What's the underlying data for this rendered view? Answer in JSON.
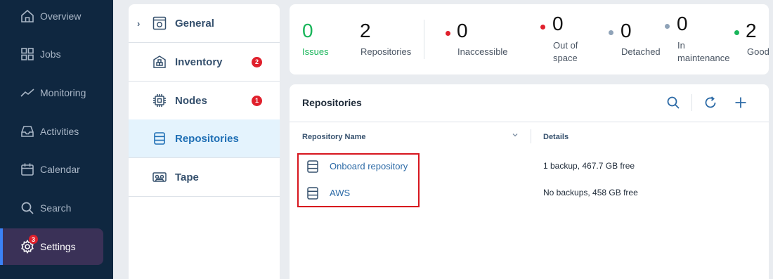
{
  "nav": {
    "items": [
      {
        "label": "Overview"
      },
      {
        "label": "Jobs"
      },
      {
        "label": "Monitoring"
      },
      {
        "label": "Activities"
      },
      {
        "label": "Calendar"
      },
      {
        "label": "Search"
      },
      {
        "label": "Settings",
        "badge": "3",
        "active": true
      }
    ]
  },
  "settings_menu": {
    "items": [
      {
        "label": "General",
        "icon": "gear-window-icon",
        "expandable": true
      },
      {
        "label": "Inventory",
        "icon": "inventory-icon",
        "badge": "2"
      },
      {
        "label": "Nodes",
        "icon": "chip-icon",
        "badge": "1"
      },
      {
        "label": "Repositories",
        "icon": "database-icon",
        "active": true
      },
      {
        "label": "Tape",
        "icon": "tape-icon"
      }
    ]
  },
  "stats": {
    "issues": {
      "value": "0",
      "label": "Issues",
      "color": "#19b55a"
    },
    "repositories": {
      "value": "2",
      "label": "Repositories"
    },
    "inaccessible": {
      "value": "0",
      "label": "Inaccessible",
      "dot_color": "#e0202c"
    },
    "out_of_space": {
      "value": "0",
      "label_line1": "Out of",
      "label_line2": "space",
      "dot_color": "#e0202c"
    },
    "detached": {
      "value": "0",
      "label": "Detached",
      "dot_color": "#8fa3b8"
    },
    "in_maintenance": {
      "value": "0",
      "label_line1": "In",
      "label_line2": "maintenance",
      "dot_color": "#8fa3b8"
    },
    "good": {
      "value": "2",
      "label": "Good",
      "dot_color": "#19b55a"
    }
  },
  "repositories_panel": {
    "title": "Repositories",
    "toolbar": [
      "search-icon",
      "refresh-icon",
      "add-icon"
    ],
    "columns": {
      "name": "Repository Name",
      "details": "Details"
    },
    "rows": [
      {
        "name": "Onboard repository",
        "details": "1 backup, 467.7 GB free"
      },
      {
        "name": "AWS",
        "details": "No backups, 458  GB free"
      }
    ]
  },
  "colors": {
    "nav_bg": "#0f2740",
    "nav_active_bg": "#3a3157",
    "accent": "#1f6fb5",
    "badge": "#e0202c",
    "highlight_border": "#d7161e"
  }
}
